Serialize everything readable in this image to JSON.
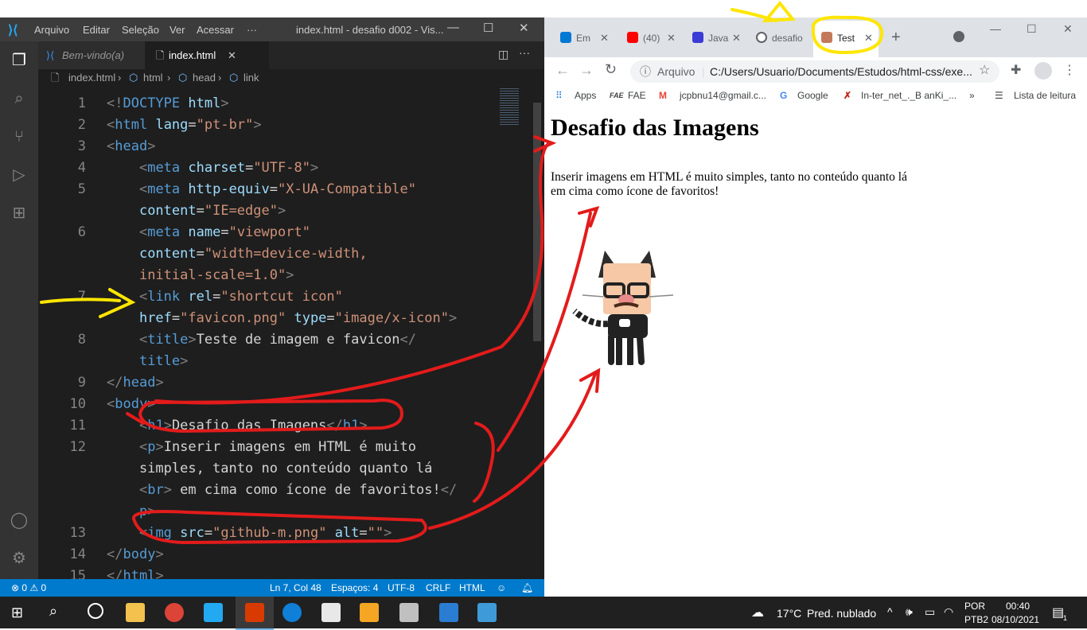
{
  "vscode": {
    "menu": [
      "Arquivo",
      "Editar",
      "Seleção",
      "Ver",
      "Acessar",
      "···"
    ],
    "window_title": "index.html - desafio d002 - Vis...",
    "tabs": [
      {
        "label": "Bem-vindo(a)"
      },
      {
        "label": "index.html",
        "close": "✕"
      }
    ],
    "breadcrumb": [
      "index.html",
      "html",
      "head",
      "link"
    ],
    "lines": [
      {
        "n": "1",
        "parts": [
          [
            "t",
            "<!"
          ],
          [
            "tg",
            "DOCTYPE"
          ],
          [
            "tx",
            " "
          ],
          [
            "at",
            "html"
          ],
          [
            "t",
            ">"
          ]
        ]
      },
      {
        "n": "2",
        "parts": [
          [
            "t",
            "<"
          ],
          [
            "tg",
            "html"
          ],
          [
            "tx",
            " "
          ],
          [
            "at",
            "lang"
          ],
          [
            "tx",
            "="
          ],
          [
            "s",
            "\"pt-br\""
          ],
          [
            "t",
            ">"
          ]
        ]
      },
      {
        "n": "3",
        "parts": [
          [
            "t",
            "<"
          ],
          [
            "tg",
            "head"
          ],
          [
            "t",
            ">"
          ]
        ]
      },
      {
        "n": "4",
        "parts": [
          [
            "tx",
            "    "
          ],
          [
            "t",
            "<"
          ],
          [
            "tg",
            "meta"
          ],
          [
            "tx",
            " "
          ],
          [
            "at",
            "charset"
          ],
          [
            "tx",
            "="
          ],
          [
            "s",
            "\"UTF-8\""
          ],
          [
            "t",
            ">"
          ]
        ]
      },
      {
        "n": "5",
        "parts": [
          [
            "tx",
            "    "
          ],
          [
            "t",
            "<"
          ],
          [
            "tg",
            "meta"
          ],
          [
            "tx",
            " "
          ],
          [
            "at",
            "http-equiv"
          ],
          [
            "tx",
            "="
          ],
          [
            "s",
            "\"X-UA-Compatible\""
          ]
        ]
      },
      {
        "n": "",
        "parts": [
          [
            "tx",
            "    "
          ],
          [
            "at",
            "content"
          ],
          [
            "tx",
            "="
          ],
          [
            "s",
            "\"IE=edge\""
          ],
          [
            "t",
            ">"
          ]
        ]
      },
      {
        "n": "6",
        "parts": [
          [
            "tx",
            "    "
          ],
          [
            "t",
            "<"
          ],
          [
            "tg",
            "meta"
          ],
          [
            "tx",
            " "
          ],
          [
            "at",
            "name"
          ],
          [
            "tx",
            "="
          ],
          [
            "s",
            "\"viewport\""
          ]
        ]
      },
      {
        "n": "",
        "parts": [
          [
            "tx",
            "    "
          ],
          [
            "at",
            "content"
          ],
          [
            "tx",
            "="
          ],
          [
            "s",
            "\"width=device-width,"
          ]
        ]
      },
      {
        "n": "",
        "parts": [
          [
            "tx",
            "    "
          ],
          [
            "s",
            "initial-scale=1.0\""
          ],
          [
            "t",
            ">"
          ]
        ]
      },
      {
        "n": "7",
        "parts": [
          [
            "tx",
            "    "
          ],
          [
            "t",
            "<"
          ],
          [
            "tg",
            "link"
          ],
          [
            "tx",
            " "
          ],
          [
            "at",
            "rel"
          ],
          [
            "tx",
            "="
          ],
          [
            "s",
            "\"shortcut icon\""
          ]
        ]
      },
      {
        "n": "",
        "parts": [
          [
            "tx",
            "    "
          ],
          [
            "at",
            "href"
          ],
          [
            "tx",
            "="
          ],
          [
            "s",
            "\"favicon.png\""
          ],
          [
            "tx",
            " "
          ],
          [
            "at",
            "type"
          ],
          [
            "tx",
            "="
          ],
          [
            "s",
            "\"image/x-icon\""
          ],
          [
            "t",
            ">"
          ]
        ]
      },
      {
        "n": "8",
        "parts": [
          [
            "tx",
            "    "
          ],
          [
            "t",
            "<"
          ],
          [
            "tg",
            "title"
          ],
          [
            "t",
            ">"
          ],
          [
            "tx",
            "Teste de imagem e favicon"
          ],
          [
            "t",
            "</"
          ]
        ]
      },
      {
        "n": "",
        "parts": [
          [
            "tx",
            "    "
          ],
          [
            "tg",
            "title"
          ],
          [
            "t",
            ">"
          ]
        ]
      },
      {
        "n": "9",
        "parts": [
          [
            "t",
            "</"
          ],
          [
            "tg",
            "head"
          ],
          [
            "t",
            ">"
          ]
        ]
      },
      {
        "n": "10",
        "parts": [
          [
            "t",
            "<"
          ],
          [
            "tg",
            "body"
          ],
          [
            "t",
            ">"
          ]
        ]
      },
      {
        "n": "11",
        "parts": [
          [
            "tx",
            "    "
          ],
          [
            "t",
            "<"
          ],
          [
            "tg",
            "h1"
          ],
          [
            "t",
            ">"
          ],
          [
            "tx",
            "Desafio das Imagens"
          ],
          [
            "t",
            "</"
          ],
          [
            "tg",
            "h1"
          ],
          [
            "t",
            ">"
          ]
        ]
      },
      {
        "n": "12",
        "parts": [
          [
            "tx",
            "    "
          ],
          [
            "t",
            "<"
          ],
          [
            "tg",
            "p"
          ],
          [
            "t",
            ">"
          ],
          [
            "tx",
            "Inserir imagens em HTML é muito"
          ]
        ]
      },
      {
        "n": "",
        "parts": [
          [
            "tx",
            "    simples, tanto no conteúdo quanto lá"
          ]
        ]
      },
      {
        "n": "",
        "parts": [
          [
            "tx",
            "    "
          ],
          [
            "t",
            "<"
          ],
          [
            "tg",
            "br"
          ],
          [
            "t",
            ">"
          ],
          [
            "tx",
            " em cima como ícone de favoritos!"
          ],
          [
            "t",
            "</"
          ]
        ]
      },
      {
        "n": "",
        "parts": [
          [
            "tx",
            "    "
          ],
          [
            "tg",
            "p"
          ],
          [
            "t",
            ">"
          ]
        ]
      },
      {
        "n": "13",
        "parts": [
          [
            "tx",
            "    "
          ],
          [
            "t",
            "<"
          ],
          [
            "tg",
            "img"
          ],
          [
            "tx",
            " "
          ],
          [
            "at",
            "src"
          ],
          [
            "tx",
            "="
          ],
          [
            "s",
            "\"github-m.png\""
          ],
          [
            "tx",
            " "
          ],
          [
            "at",
            "alt"
          ],
          [
            "tx",
            "="
          ],
          [
            "s",
            "\"\""
          ],
          [
            "t",
            ">"
          ]
        ]
      },
      {
        "n": "14",
        "parts": [
          [
            "t",
            "</"
          ],
          [
            "tg",
            "body"
          ],
          [
            "t",
            ">"
          ]
        ]
      },
      {
        "n": "15",
        "parts": [
          [
            "t",
            "</"
          ],
          [
            "tg",
            "html"
          ],
          [
            "t",
            ">"
          ]
        ]
      }
    ],
    "status": {
      "problems": "⊗ 0 ⚠ 0",
      "position": "Ln 7, Col 48",
      "spaces": "Espaços: 4",
      "encoding": "UTF-8",
      "eol": "CRLF",
      "language": "HTML"
    },
    "colors": {
      "accent": "#007acc",
      "title_bg": "#3c3c3c",
      "editor_bg": "#1e1e1e"
    }
  },
  "chrome": {
    "tabs": [
      {
        "label": "Em",
        "icon_color": "#0078d4"
      },
      {
        "label": "(40)",
        "icon_color": "#ff0000"
      },
      {
        "label": "Java",
        "icon_color": "#3b3bd6"
      },
      {
        "label": "desafio",
        "icon_color": "#5f6368"
      },
      {
        "label": "Test",
        "icon_color": "#c47a5a"
      }
    ],
    "address_label": "Arquivo",
    "address": "C:/Users/Usuario/Documents/Estudos/html-css/exe...",
    "bookmarks": [
      "Apps",
      "FAE",
      "jcpbnu14@gmail.c...",
      "Google",
      "In-ter_net_._B anKi_...",
      "»",
      "Lista de leitura"
    ],
    "page": {
      "h1": "Desafio das Imagens",
      "p_line1": "Inserir imagens em HTML é muito simples, tanto no conteúdo quanto lá",
      "p_line2": "em cima como ícone de favoritos!"
    }
  },
  "taskbar": {
    "weather_temp": "17°C",
    "weather_text": "Pred. nublado",
    "lang1": "POR",
    "lang2": "PTB2",
    "time": "00:40",
    "date": "08/10/2021",
    "notification_count": "1"
  }
}
